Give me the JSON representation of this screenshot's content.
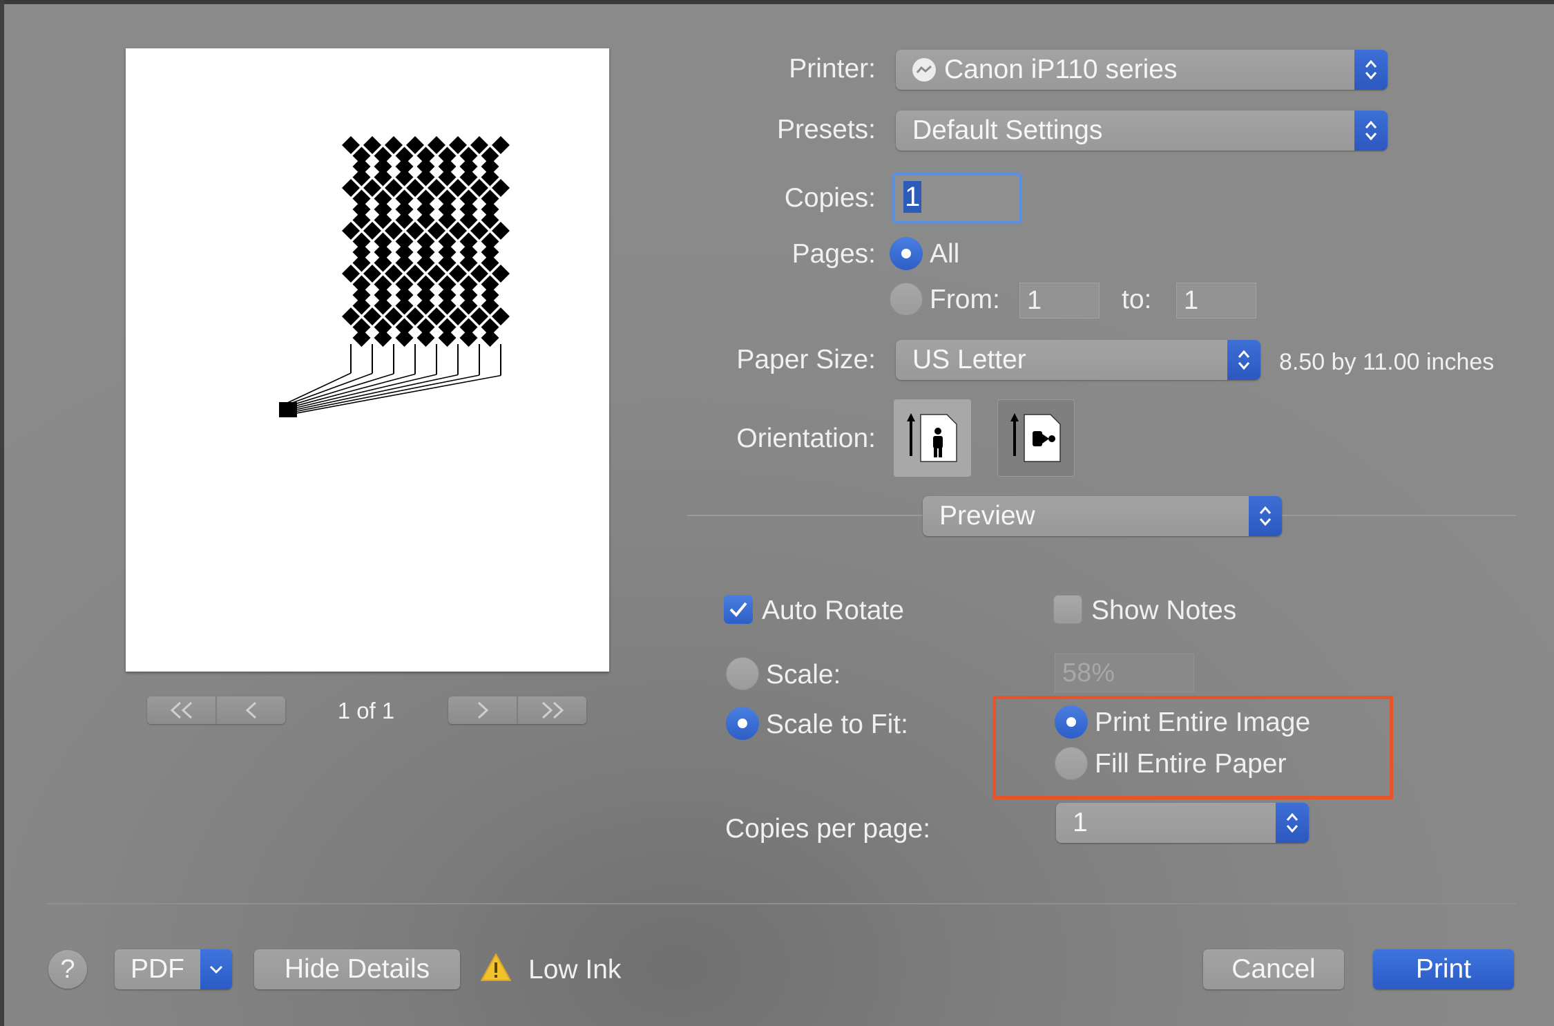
{
  "preview": {
    "page_indicator": "1 of 1",
    "nav": {
      "first": "<<",
      "prev": "<",
      "next": ">",
      "last": ">>"
    }
  },
  "printer": {
    "label": "Printer:",
    "value": "Canon iP110 series"
  },
  "presets": {
    "label": "Presets:",
    "value": "Default Settings"
  },
  "copies": {
    "label": "Copies:",
    "value": "1"
  },
  "pages": {
    "label": "Pages:",
    "all_label": "All",
    "from_label": "From:",
    "from_value": "1",
    "to_label": "to:",
    "to_value": "1",
    "selected": "All"
  },
  "paper_size": {
    "label": "Paper Size:",
    "value": "US Letter",
    "dimensions": "8.50 by 11.00 inches"
  },
  "orientation": {
    "label": "Orientation:",
    "selected": "portrait"
  },
  "section_popup": {
    "value": "Preview"
  },
  "preview_options": {
    "auto_rotate": {
      "label": "Auto Rotate",
      "checked": true
    },
    "show_notes": {
      "label": "Show Notes",
      "checked": false
    },
    "scale": {
      "label": "Scale:",
      "value": "58%",
      "selected": false
    },
    "scale_to_fit": {
      "label": "Scale to Fit:",
      "selected": true
    },
    "print_entire_image": {
      "label": "Print Entire Image",
      "selected": true
    },
    "fill_entire_paper": {
      "label": "Fill Entire Paper",
      "selected": false
    },
    "copies_per_page": {
      "label": "Copies per page:",
      "value": "1"
    }
  },
  "footer": {
    "help": "?",
    "pdf": "PDF",
    "hide_details": "Hide Details",
    "status": "Low Ink",
    "cancel": "Cancel",
    "print": "Print"
  },
  "colors": {
    "accent": "#2d5fc7",
    "highlight": "#e8542a",
    "warning": "#f2c12e"
  }
}
